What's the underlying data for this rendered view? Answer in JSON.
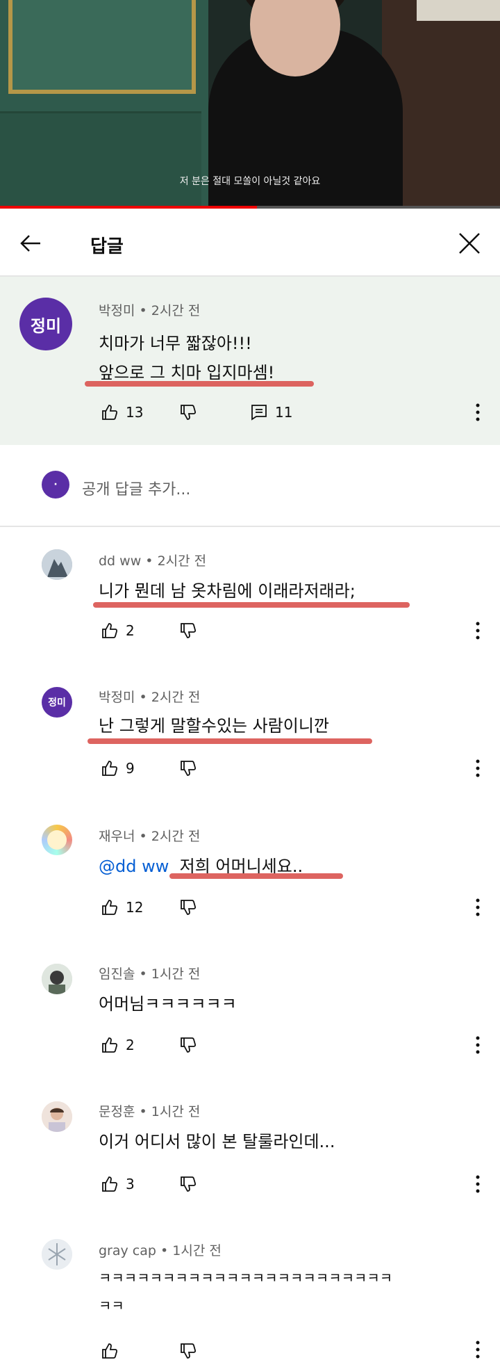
{
  "video": {
    "subtitle": "저 분은 절대 모쏠이 아닐것 같아요"
  },
  "header": {
    "title": "답글"
  },
  "top_comment": {
    "avatar_text": "정미",
    "author": "박정미",
    "time": "2시간 전",
    "line1": "치마가 너무 짧잖아!!!",
    "line2": "앞으로 그 치마 입지마셈!",
    "likes": "13",
    "replies": "11"
  },
  "add_reply": {
    "placeholder": "공개 답글 추가..."
  },
  "replies": [
    {
      "author": "dd ww",
      "time": "2시간 전",
      "text": "니가 뭔데 남 옷차림에 이래라저래라;",
      "likes": "2"
    },
    {
      "author": "박정미",
      "avatar_text": "정미",
      "time": "2시간 전",
      "text": "난 그렇게 말할수있는 사람이니깐",
      "likes": "9"
    },
    {
      "author": "재우너",
      "time": "2시간 전",
      "mention": "@dd ww",
      "text": "저희 어머니세요..",
      "likes": "12"
    },
    {
      "author": "임진솔",
      "time": "1시간 전",
      "text": "어머님ㅋㅋㅋㅋㅋㅋ",
      "likes": "2"
    },
    {
      "author": "문정훈",
      "time": "1시간 전",
      "text": "이거 어디서 많이 본 탈룰라인데...",
      "likes": "3"
    },
    {
      "author": "gray cap",
      "time": "1시간 전",
      "text": "ㅋㅋㅋㅋㅋㅋㅋㅋㅋㅋㅋㅋㅋㅋㅋㅋㅋㅋㅋㅋㅋㅋㅋ",
      "text2": "ㅋㅋ",
      "likes": ""
    }
  ],
  "colors": {
    "accent_red": "#d9534f",
    "avatar_purple": "#5a2ea6",
    "mention_blue": "#065fd4"
  },
  "separator": "•"
}
